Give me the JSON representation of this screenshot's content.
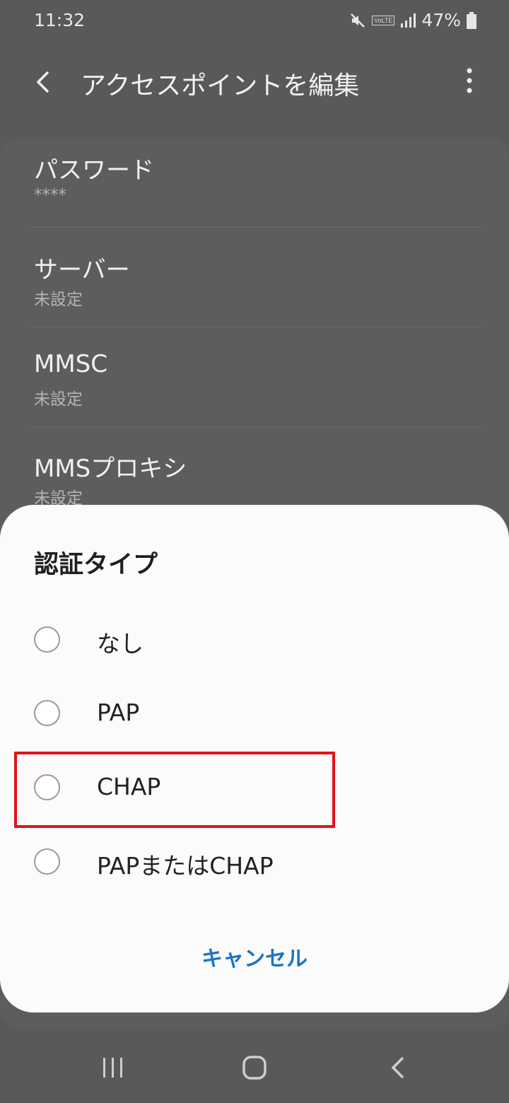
{
  "status": {
    "time": "11:32",
    "battery": "47%",
    "volte": "VoLTE",
    "icons": [
      "mute-icon",
      "volte-icon",
      "signal-icon",
      "battery-icon"
    ]
  },
  "app_bar": {
    "title": "アクセスポイントを編集",
    "back_icon": "chevron-left-icon",
    "more_icon": "more-vertical-icon"
  },
  "settings": [
    {
      "title": "パスワード",
      "value": "****"
    },
    {
      "title": "サーバー",
      "value": "未設定"
    },
    {
      "title": "MMSC",
      "value": "未設定"
    },
    {
      "title": "MMSプロキシ",
      "value": "未設定"
    }
  ],
  "dialog": {
    "title": "認証タイプ",
    "options": [
      "なし",
      "PAP",
      "CHAP",
      "PAPまたはCHAP"
    ],
    "highlighted_option": "CHAP",
    "cancel_label": "キャンセル",
    "colors": {
      "accent": "#1c74c6",
      "highlight": "#e2121b"
    }
  },
  "nav": {
    "recent_icon": "recent-apps-icon",
    "home_icon": "home-icon",
    "back_icon": "back-icon"
  }
}
